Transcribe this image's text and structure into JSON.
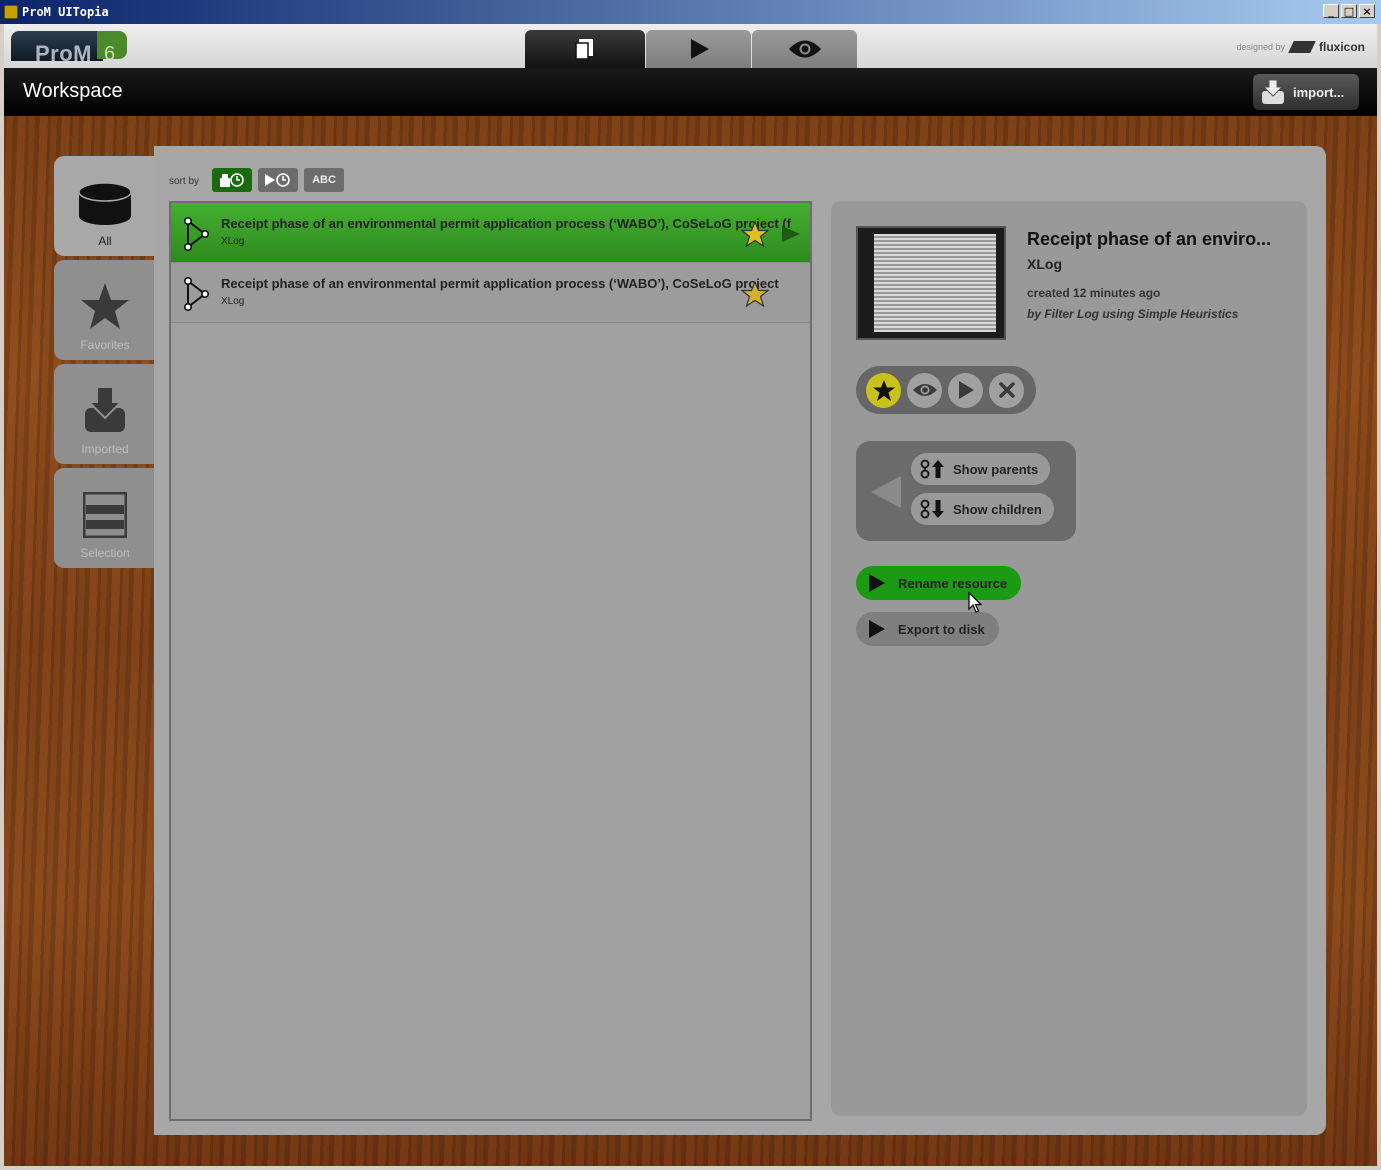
{
  "window": {
    "title": "ProM UITopia",
    "controls": [
      "_",
      "□",
      "×"
    ]
  },
  "logo": {
    "text": "ProM",
    "version": "6"
  },
  "top_tabs": [
    {
      "icon": "workspace-icon",
      "active": true
    },
    {
      "icon": "play-icon",
      "active": false
    },
    {
      "icon": "eye-icon",
      "active": false
    }
  ],
  "designed_by": {
    "label": "designed by",
    "brand": "fluxicon"
  },
  "workspace": {
    "title": "Workspace",
    "import_label": "import..."
  },
  "sidebar": {
    "items": [
      {
        "label": "All",
        "icon": "database-icon",
        "active": true
      },
      {
        "label": "Favorites",
        "icon": "star-icon",
        "active": false
      },
      {
        "label": "Imported",
        "icon": "import-icon",
        "active": false
      },
      {
        "label": "Selection",
        "icon": "selection-icon",
        "active": false
      }
    ]
  },
  "sort": {
    "label": "sort by",
    "options": [
      "created",
      "executed",
      "ABC"
    ],
    "abc_label": "ABC",
    "active": 0
  },
  "resources": [
    {
      "name": "Receipt phase of an environmental permit application process (‘WABO’), CoSeLoG project (f",
      "type": "XLog",
      "selected": true
    },
    {
      "name": "Receipt phase of an environmental permit application process (‘WABO’), CoSeLoG project",
      "type": "XLog",
      "selected": false
    }
  ],
  "details": {
    "title": "Receipt phase of an enviro...",
    "type": "XLog",
    "created": "created 12 minutes ago",
    "by": "by Filter Log using Simple Heuristics",
    "show_parents": "Show parents",
    "show_children": "Show children",
    "rename": "Rename resource",
    "export": "Export to disk"
  },
  "colors": {
    "accent_green": "#2d8a1e",
    "favorite_yellow": "#c9c21c",
    "panel_gray": "#a7a7a7"
  }
}
